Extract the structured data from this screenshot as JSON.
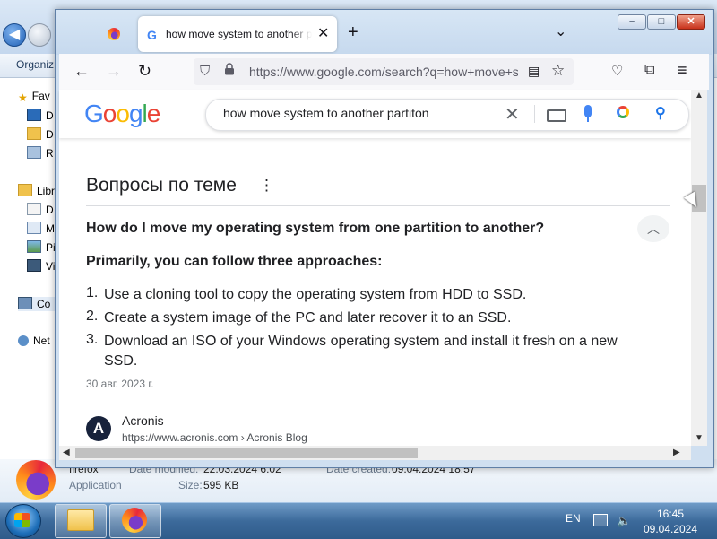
{
  "explorer": {
    "toolbar": {
      "organize": "Organiz"
    },
    "nav_items": [
      {
        "icon": "star-icon",
        "label": "Fav"
      },
      {
        "icon": "desktop-icon",
        "label": "D"
      },
      {
        "icon": "downloads-icon",
        "label": "D"
      },
      {
        "icon": "recent-places-icon",
        "label": "R"
      },
      {
        "icon": "libraries-icon",
        "label": "Libr"
      },
      {
        "icon": "documents-icon",
        "label": "D"
      },
      {
        "icon": "music-icon",
        "label": "M"
      },
      {
        "icon": "pictures-icon",
        "label": "Pi"
      },
      {
        "icon": "videos-icon",
        "label": "Vi"
      },
      {
        "icon": "computer-icon",
        "label": "Co"
      },
      {
        "icon": "network-icon",
        "label": "Net"
      }
    ],
    "details": {
      "name": "firefox",
      "type": "Application",
      "date_modified_label": "Date modified:",
      "date_modified": "22.03.2024 6:02",
      "date_created_label": "Date created:",
      "date_created": "09.04.2024 18:57",
      "size_label": "Size:",
      "size": "595 KB"
    }
  },
  "firefox": {
    "tabs": [
      {
        "title": "",
        "active": false
      },
      {
        "title": "how move system to another partiton - Google Search",
        "active": true
      }
    ],
    "url": "https://www.google.com/search?q=how+move+system+to+another+partiton",
    "window_controls": {
      "minimize": "–",
      "maximize": "□",
      "close": "✕"
    }
  },
  "google": {
    "logo": [
      "G",
      "o",
      "o",
      "g",
      "l",
      "e"
    ],
    "logo_colors": [
      "#4285f4",
      "#ea4335",
      "#fbbc04",
      "#4285f4",
      "#34a853",
      "#ea4335"
    ],
    "query": "how move system to another partiton",
    "paa_title": "Вопросы по теме",
    "question": "How do I move my operating system from one partition to another?",
    "answer_lead": "Primarily, you can follow three approaches:",
    "answer_items": [
      "Use a cloning tool to copy the operating system from HDD to SSD.",
      "Create a system image of the PC and later recover it to an SSD.",
      "Download an ISO of your Windows operating system and install it fresh on a new SSD."
    ],
    "date": "30 авг. 2023 г.",
    "source": {
      "logo_letter": "A",
      "name": "Acronis",
      "url": "https://www.acronis.com › Acronis Blog"
    }
  },
  "taskbar": {
    "language": "EN",
    "time": "16:45",
    "date": "09.04.2024"
  }
}
